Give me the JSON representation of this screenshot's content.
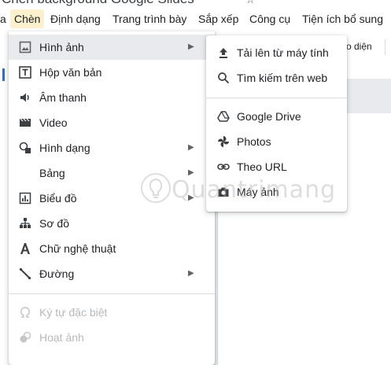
{
  "doc_title": "Chèn background Google Slides",
  "menubar": {
    "items": [
      "Chèn",
      "Định dạng",
      "Trang trình bày",
      "Sắp xếp",
      "Công cụ",
      "Tiện ích bổ sung"
    ]
  },
  "toolbar": {
    "layout_label": "o diện"
  },
  "insert_menu": {
    "items": [
      {
        "label": "Hình ảnh",
        "icon": "image-icon",
        "has_submenu": true,
        "enabled": true
      },
      {
        "label": "Hộp văn bản",
        "icon": "text-box-icon",
        "has_submenu": false,
        "enabled": true
      },
      {
        "label": "Âm thanh",
        "icon": "audio-icon",
        "has_submenu": false,
        "enabled": true
      },
      {
        "label": "Video",
        "icon": "video-icon",
        "has_submenu": false,
        "enabled": true
      },
      {
        "label": "Hình dạng",
        "icon": "shapes-icon",
        "has_submenu": true,
        "enabled": true
      },
      {
        "label": "Bảng",
        "icon": "",
        "has_submenu": true,
        "enabled": true
      },
      {
        "label": "Biểu đồ",
        "icon": "chart-icon",
        "has_submenu": true,
        "enabled": true
      },
      {
        "label": "Sơ đồ",
        "icon": "diagram-icon",
        "has_submenu": false,
        "enabled": true
      },
      {
        "label": "Chữ nghệ thuật",
        "icon": "word-art-icon",
        "has_submenu": false,
        "enabled": true
      },
      {
        "label": "Đường",
        "icon": "line-icon",
        "has_submenu": true,
        "enabled": true
      },
      {
        "label": "Ký tự đặc biệt",
        "icon": "omega-icon",
        "has_submenu": false,
        "enabled": false
      },
      {
        "label": "Hoạt ảnh",
        "icon": "animation-icon",
        "has_submenu": false,
        "enabled": false
      }
    ]
  },
  "image_submenu": {
    "items": [
      {
        "label": "Tải lên từ máy tính",
        "icon": "upload-icon"
      },
      {
        "label": "Tìm kiếm trên web",
        "icon": "search-icon"
      },
      {
        "label": "Google Drive",
        "icon": "google-drive-icon"
      },
      {
        "label": "Photos",
        "icon": "photos-pinwheel-icon"
      },
      {
        "label": "Theo URL",
        "icon": "link-icon"
      },
      {
        "label": "Máy ảnh",
        "icon": "camera-icon"
      }
    ]
  },
  "watermark": {
    "text": "Quantrimang"
  },
  "colors": {
    "active_menu_bg": "#fdf0cf",
    "hover_bg": "#e8eaed",
    "icon": "#5f6368",
    "disabled_text": "#b6b8bb"
  }
}
